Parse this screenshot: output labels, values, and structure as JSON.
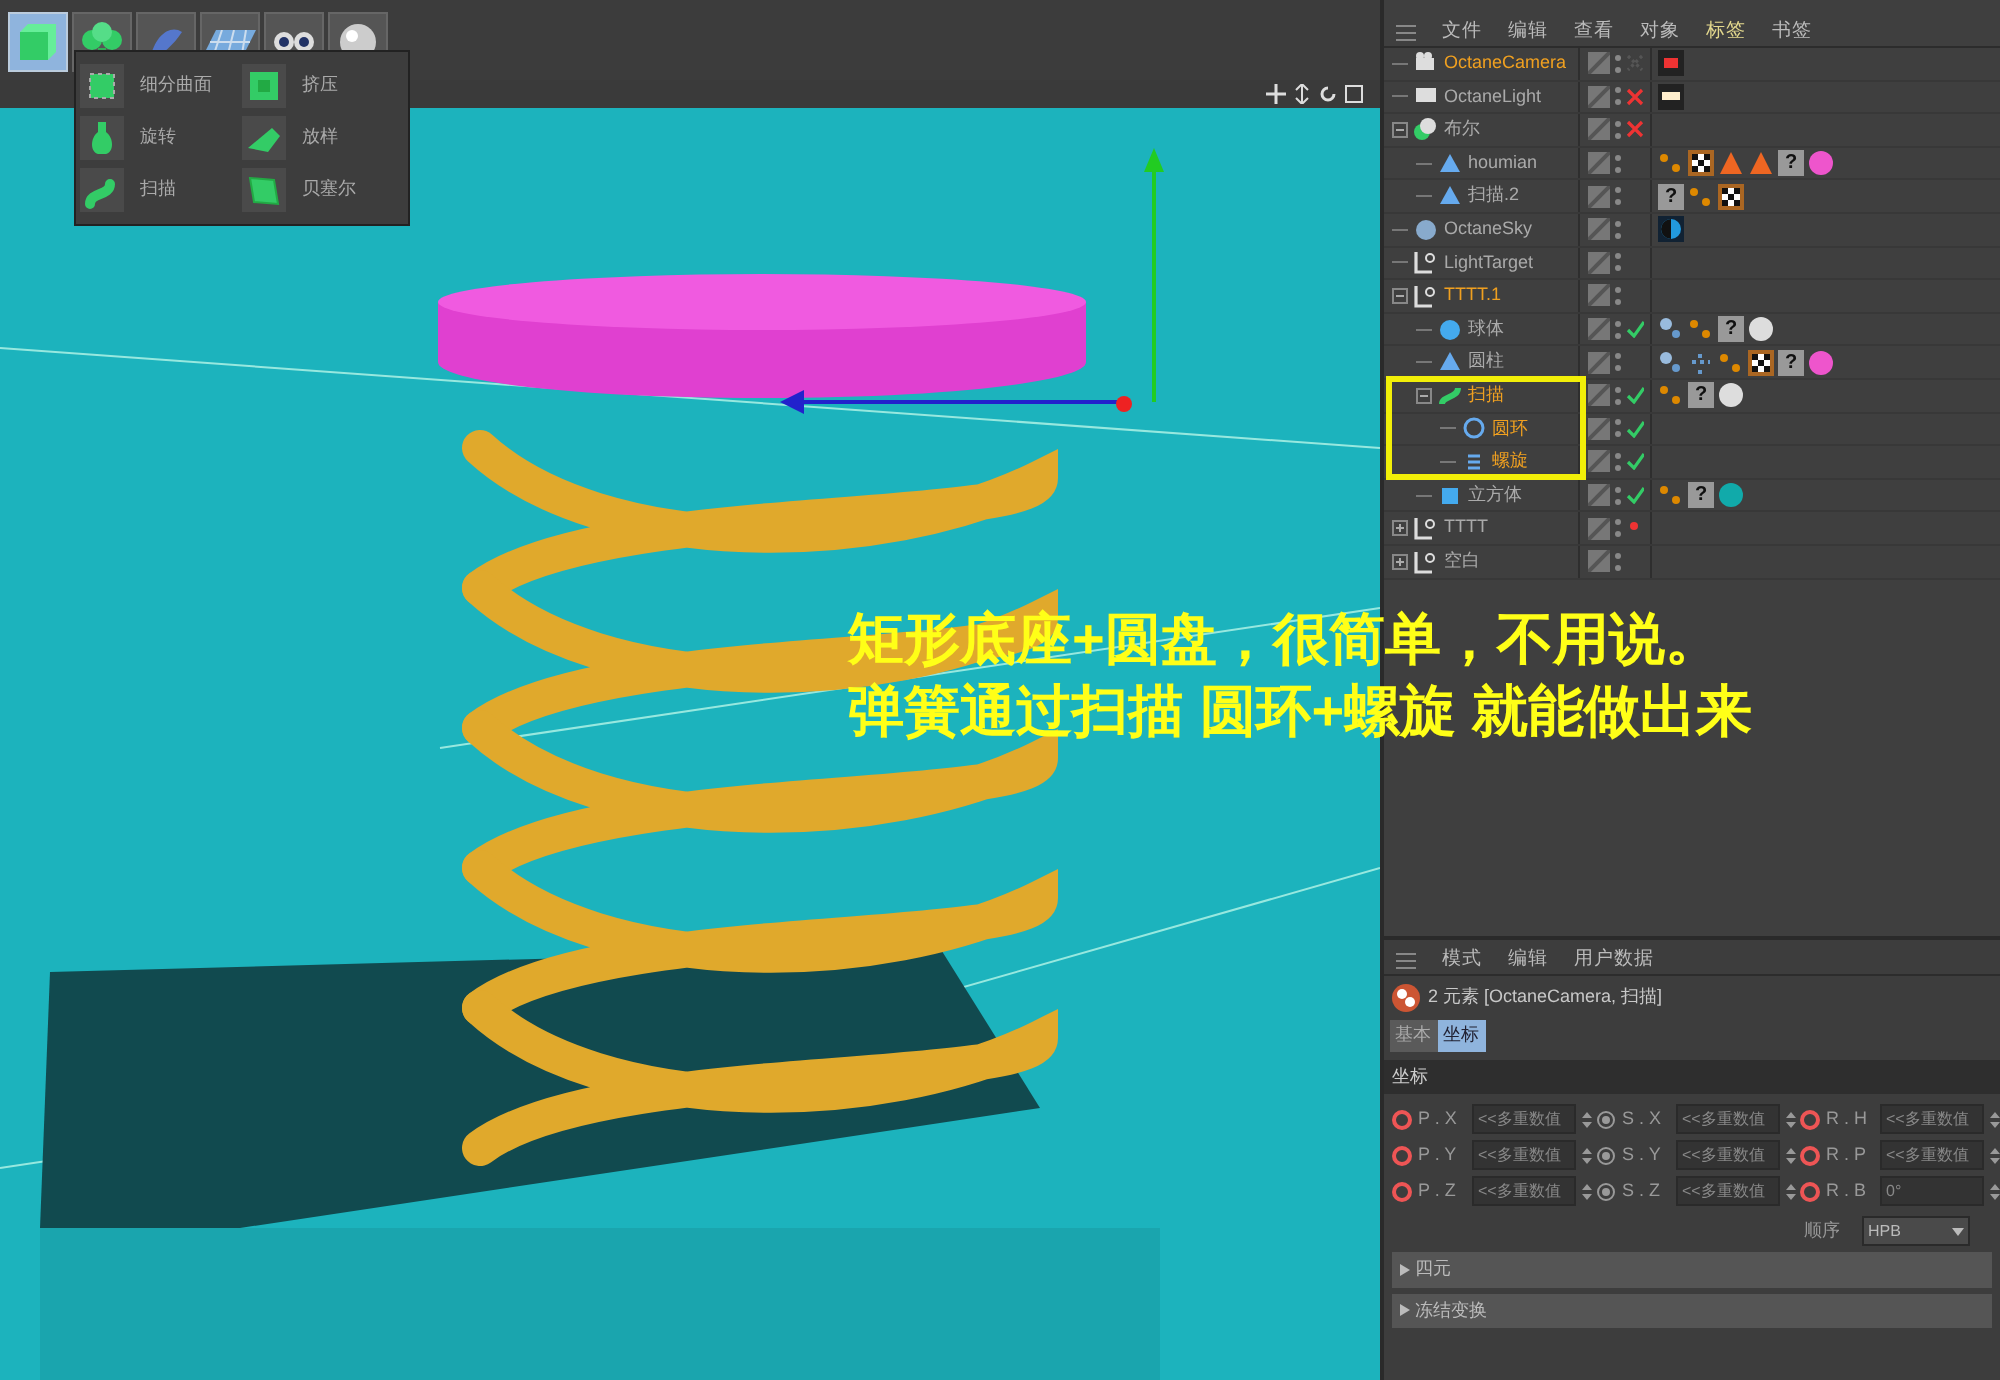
{
  "toolbar": {
    "tools": [
      {
        "kind": "cube",
        "selected": true
      },
      {
        "kind": "tree",
        "selected": false
      },
      {
        "kind": "pen",
        "selected": false
      },
      {
        "kind": "grid",
        "selected": false
      },
      {
        "kind": "eyes",
        "selected": false
      },
      {
        "kind": "light",
        "selected": false
      }
    ]
  },
  "generator_menu": {
    "items": [
      {
        "label": "细分曲面",
        "kind": "subdivision"
      },
      {
        "label": "挤压",
        "kind": "extrude"
      },
      {
        "label": "旋转",
        "kind": "lathe"
      },
      {
        "label": "放样",
        "kind": "loft"
      },
      {
        "label": "扫描",
        "kind": "sweep"
      },
      {
        "label": "贝塞尔",
        "kind": "bezier"
      }
    ]
  },
  "annotation": {
    "lines": [
      "矩形底座+圆盘，很简单，不用说。",
      "弹簧通过扫描 圆环+螺旋 就能做出来"
    ]
  },
  "object_manager": {
    "menu": [
      {
        "label": "文件",
        "selected": false
      },
      {
        "label": "编辑",
        "selected": false
      },
      {
        "label": "查看",
        "selected": false
      },
      {
        "label": "对象",
        "selected": false
      },
      {
        "label": "标签",
        "selected": true
      },
      {
        "label": "书签",
        "selected": false
      }
    ],
    "objects": [
      {
        "name": "OctaneCamera",
        "kind": "camera",
        "selected": true,
        "render": {
          "kind": "off"
        },
        "tags": [
          {
            "kind": "camera"
          }
        ]
      },
      {
        "name": "OctaneLight",
        "kind": "light",
        "selected": false,
        "render": {
          "kind": "cross"
        },
        "tags": [
          {
            "kind": "lamp"
          }
        ]
      },
      {
        "name": "布尔",
        "kind": "boole",
        "selected": false,
        "render": {
          "kind": "cross"
        },
        "expanded": true,
        "children": [
          {
            "name": "houmian",
            "kind": "poly",
            "selected": false,
            "tags": [
              {
                "kind": "dots"
              },
              {
                "kind": "checker"
              },
              {
                "kind": "cone"
              },
              {
                "kind": "cone"
              },
              {
                "kind": "question",
                "label": "?"
              },
              {
                "kind": "pink"
              }
            ]
          },
          {
            "name": "扫描.2",
            "kind": "poly",
            "selected": false,
            "tags": [
              {
                "kind": "question",
                "label": "?"
              },
              {
                "kind": "dots"
              },
              {
                "kind": "checker"
              }
            ]
          }
        ]
      },
      {
        "name": "OctaneSky",
        "kind": "sky",
        "selected": false,
        "tags": [
          {
            "kind": "sky"
          }
        ]
      },
      {
        "name": "LightTarget",
        "kind": "null",
        "selected": false
      },
      {
        "name": "TTTT.1",
        "kind": "null",
        "selected": true,
        "expanded": true,
        "children": [
          {
            "name": "球体",
            "kind": "sphere",
            "selected": false,
            "render": {
              "kind": "check"
            },
            "tags": [
              {
                "kind": "points"
              },
              {
                "kind": "dots"
              },
              {
                "kind": "question",
                "label": "?"
              },
              {
                "kind": "white"
              }
            ]
          },
          {
            "name": "圆柱",
            "kind": "poly",
            "selected": false,
            "tags": [
              {
                "kind": "points"
              },
              {
                "kind": "grid"
              },
              {
                "kind": "dots"
              },
              {
                "kind": "checker"
              },
              {
                "kind": "question",
                "label": "?"
              },
              {
                "kind": "pink"
              }
            ]
          },
          {
            "name": "扫描",
            "kind": "sweep",
            "selected": true,
            "render": {
              "kind": "check"
            },
            "expanded": true,
            "tags": [
              {
                "kind": "dots"
              },
              {
                "kind": "question",
                "label": "?"
              },
              {
                "kind": "white"
              }
            ],
            "children": [
              {
                "name": "圆环",
                "kind": "circle",
                "selected": true,
                "render": {
                  "kind": "check"
                }
              },
              {
                "name": "螺旋",
                "kind": "helix",
                "selected": true,
                "render": {
                  "kind": "check"
                }
              }
            ]
          },
          {
            "name": "立方体",
            "kind": "cube",
            "selected": false,
            "render": {
              "kind": "check"
            },
            "tags": [
              {
                "kind": "dots"
              },
              {
                "kind": "question",
                "label": "?"
              },
              {
                "kind": "teal"
              }
            ]
          }
        ]
      },
      {
        "name": "TTTT",
        "kind": "null",
        "selected": false,
        "render": {
          "kind": "dot"
        },
        "expanded": false
      },
      {
        "name": "空白",
        "kind": "null",
        "selected": false,
        "expanded": false
      }
    ]
  },
  "attribute_manager": {
    "menu": [
      "模式",
      "编辑",
      "用户数据"
    ],
    "title": "2 元素 [OctaneCamera, 扫描]",
    "tabs": [
      {
        "label": "基本",
        "selected": false
      },
      {
        "label": "坐标",
        "selected": true
      }
    ],
    "section": "坐标",
    "fields": [
      {
        "label": "P . X",
        "value": "<<多重数值",
        "kind": "keyed"
      },
      {
        "label": "S . X",
        "value": "<<多重数值",
        "kind": "plain"
      },
      {
        "label": "R . H",
        "value": "<<多重数值",
        "kind": "keyed"
      },
      {
        "label": "P . Y",
        "value": "<<多重数值",
        "kind": "keyed"
      },
      {
        "label": "S . Y",
        "value": "<<多重数值",
        "kind": "plain"
      },
      {
        "label": "R . P",
        "value": "<<多重数值",
        "kind": "keyed"
      },
      {
        "label": "P . Z",
        "value": "<<多重数值",
        "kind": "keyed"
      },
      {
        "label": "S . Z",
        "value": "<<多重数值",
        "kind": "plain"
      },
      {
        "label": "R . B",
        "value": "0°",
        "kind": "keyed"
      }
    ],
    "order": {
      "label": "顺序",
      "value": "HPB"
    },
    "groups": [
      {
        "label": "四元",
        "expanded": false
      },
      {
        "label": "冻结变换",
        "expanded": false
      }
    ]
  }
}
